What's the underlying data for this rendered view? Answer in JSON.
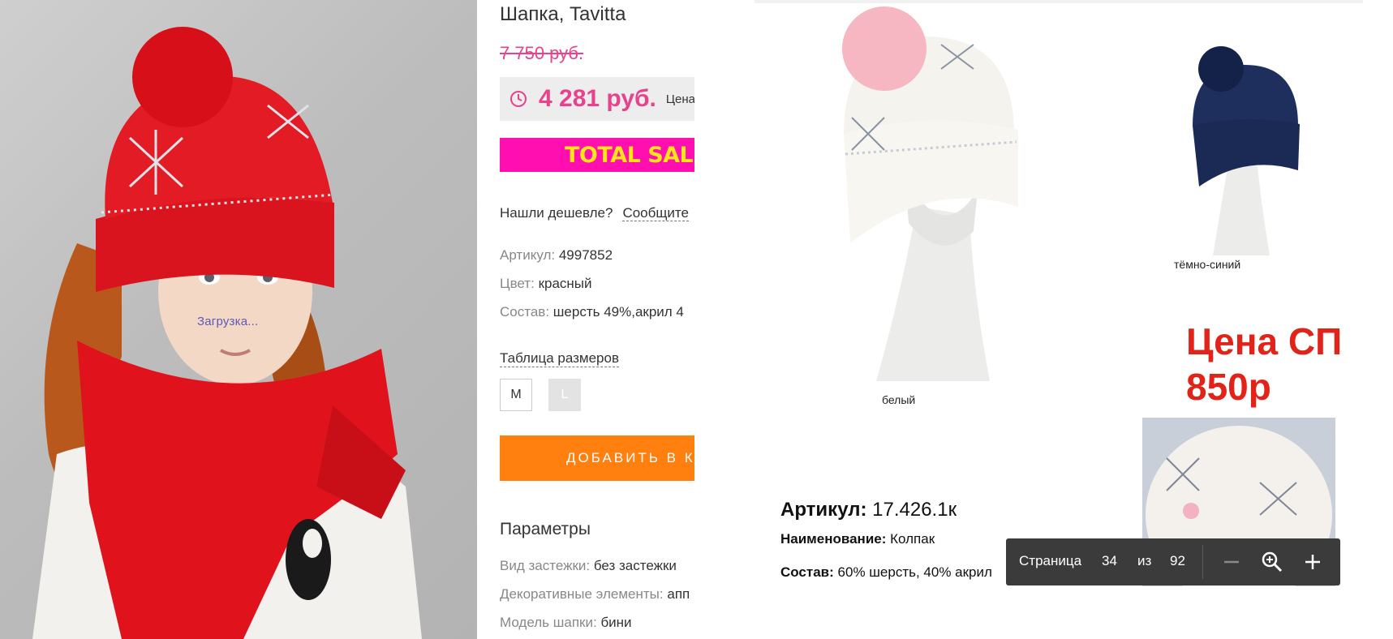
{
  "photo": {
    "loading_text": "Загрузка..."
  },
  "product": {
    "title": "Шапка, Tavitta",
    "old_price": "7 750 руб.",
    "price": "4 281 руб.",
    "price_note": "Цена",
    "banner": "TOTAL SALE",
    "cheaper_label": "Нашли дешевле?",
    "cheaper_link": "Сообщите",
    "specs": [
      {
        "key": "Артикул:",
        "value": "4997852"
      },
      {
        "key": "Цвет:",
        "value": "красный"
      },
      {
        "key": "Состав:",
        "value": "шерсть 49%,акрил 4"
      }
    ],
    "size_table_link": "Таблица размеров",
    "sizes": [
      "M",
      "L"
    ],
    "add_to_cart": "ДОБАВИТЬ В КО",
    "params_heading": "Параметры",
    "params": [
      {
        "key": "Вид застежки:",
        "value": "без застежки"
      },
      {
        "key": "Декоративные элементы:",
        "value": "апп"
      },
      {
        "key": "Модель шапки:",
        "value": "бини"
      }
    ]
  },
  "catalog": {
    "white_caption": "белый",
    "navy_caption": "тёмно-синий",
    "promo_line1": "Цена СП",
    "promo_line2": "850р",
    "article_label": "Артикул:",
    "article_value": "17.426.1к",
    "name_label": "Наименование:",
    "name_value": "Колпак",
    "composition_label": "Состав:",
    "composition_value": "60% шерсть, 40% акрил"
  },
  "pager": {
    "page_label": "Страница",
    "current_page": "34",
    "of_label": "из",
    "total_pages": "92"
  },
  "colors": {
    "pink_price": "#e8428c",
    "banner_bg": "#ff0fb0",
    "banner_text": "#ffe51a",
    "cart_orange": "#ff7f0f",
    "promo_red": "#e2231a",
    "toolbar_bg": "#3b3b3b"
  }
}
